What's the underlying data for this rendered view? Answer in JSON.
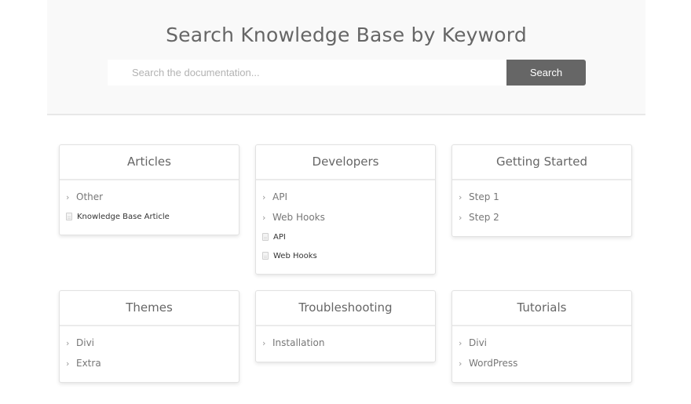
{
  "hero": {
    "title": "Search Knowledge Base by Keyword",
    "search_placeholder": "Search the documentation...",
    "search_button": "Search"
  },
  "cards": [
    {
      "title": "Articles",
      "categories": [
        "Other"
      ],
      "articles": [
        "Knowledge Base Article"
      ]
    },
    {
      "title": "Developers",
      "categories": [
        "API",
        "Web Hooks"
      ],
      "articles": [
        "API",
        "Web Hooks"
      ]
    },
    {
      "title": "Getting Started",
      "categories": [
        "Step 1",
        "Step 2"
      ],
      "articles": []
    },
    {
      "title": "Themes",
      "categories": [
        "Divi",
        "Extra"
      ],
      "articles": []
    },
    {
      "title": "Troubleshooting",
      "categories": [
        "Installation"
      ],
      "articles": []
    },
    {
      "title": "Tutorials",
      "categories": [
        "Divi",
        "WordPress"
      ],
      "articles": []
    }
  ],
  "icons": {
    "category": "chevron-right-icon",
    "article": "document-icon"
  },
  "colors": {
    "button_bg": "#666666",
    "hero_bg": "#f9f9f9",
    "heading": "#666666"
  }
}
